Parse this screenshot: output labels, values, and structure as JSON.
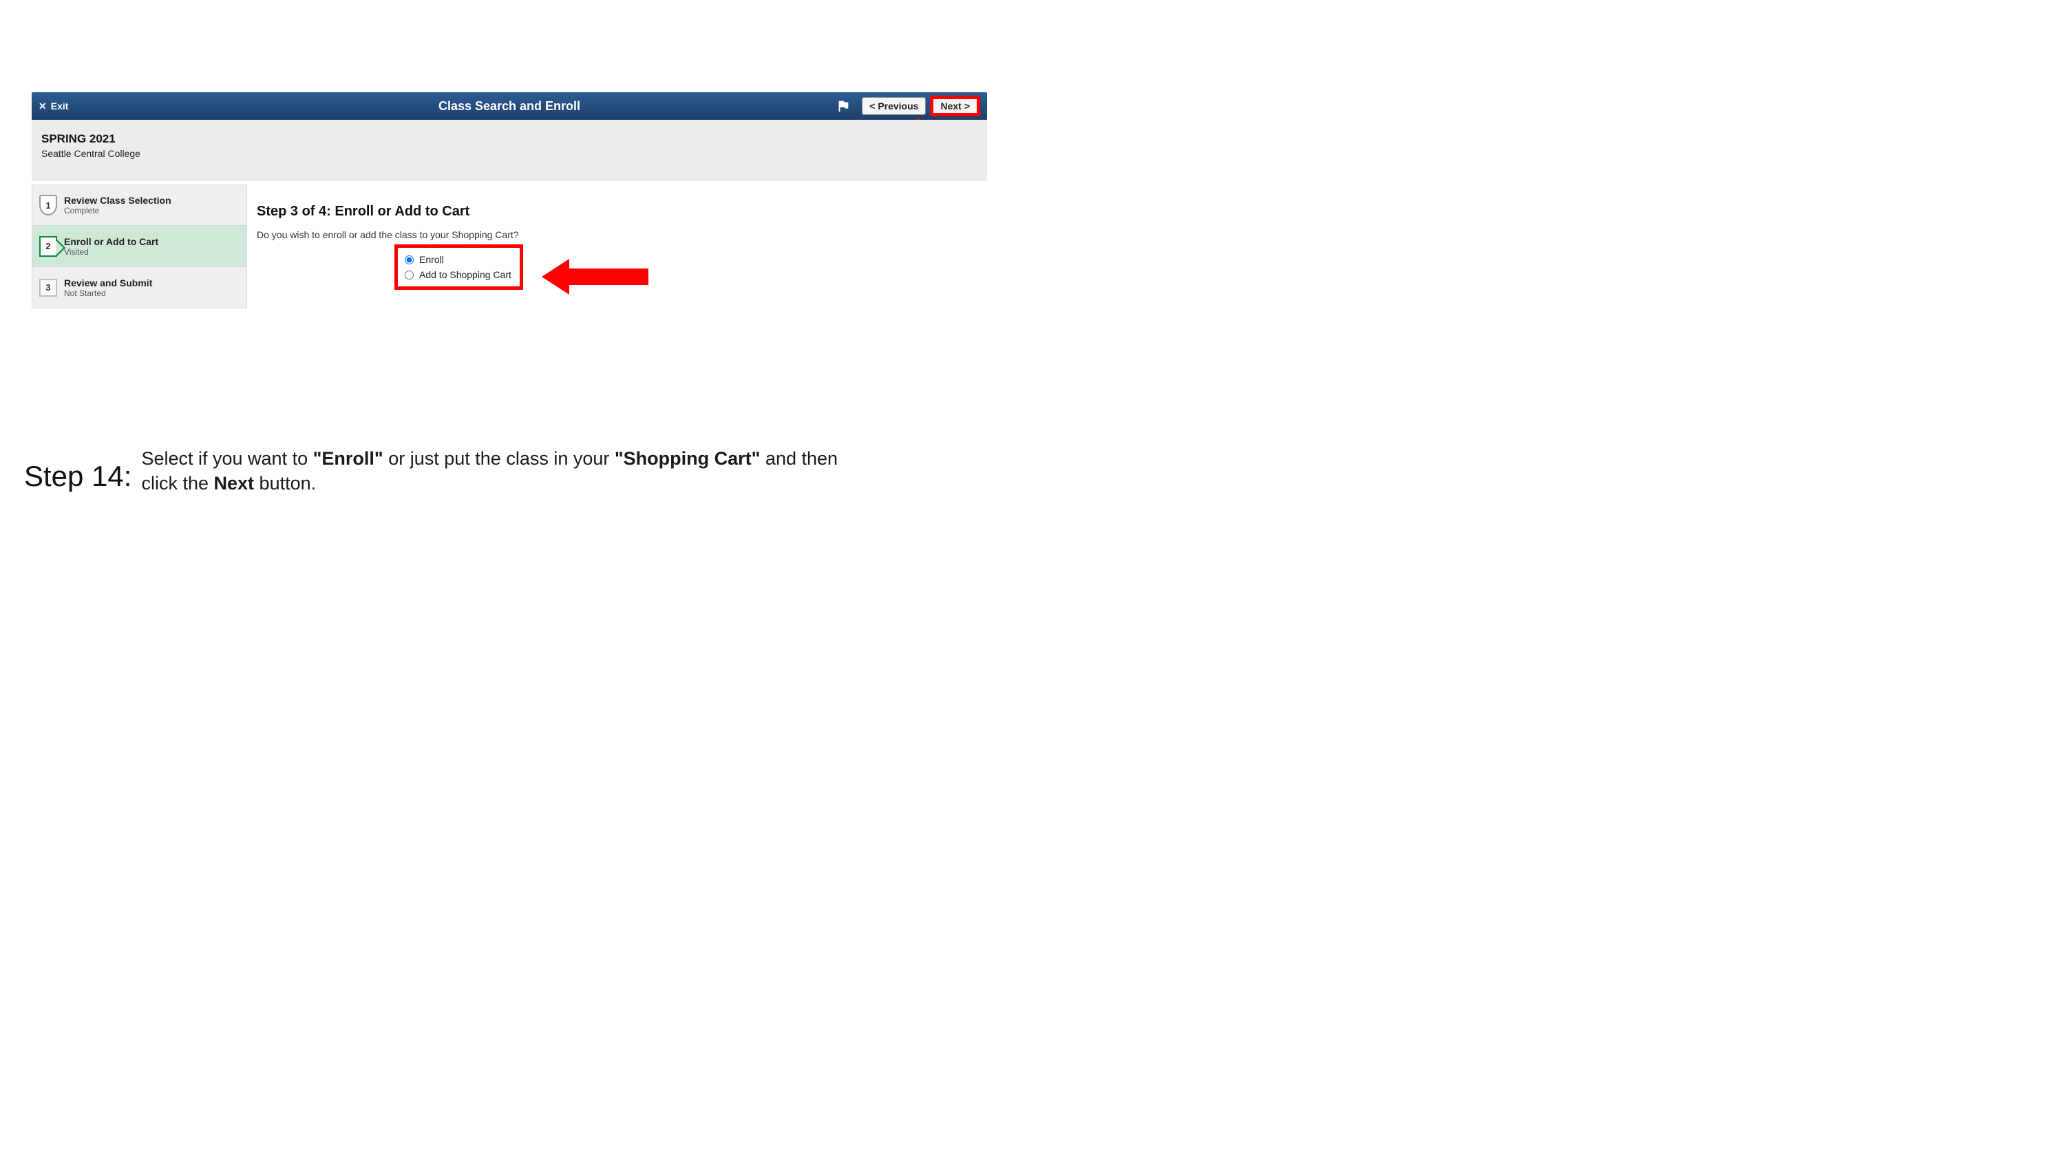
{
  "header": {
    "exit_label": "Exit",
    "title": "Class Search and Enroll",
    "previous_label": "Previous",
    "next_label": "Next"
  },
  "term_info": {
    "term": "SPRING 2021",
    "college": "Seattle Central College"
  },
  "steps": [
    {
      "num": "1",
      "title": "Review Class Selection",
      "status": "Complete"
    },
    {
      "num": "2",
      "title": "Enroll or Add to Cart",
      "status": "Visited"
    },
    {
      "num": "3",
      "title": "Review and Submit",
      "status": "Not Started"
    }
  ],
  "main": {
    "heading": "Step 3 of 4: Enroll or Add to Cart",
    "question": "Do you wish to enroll or add the class to your Shopping Cart?",
    "option_enroll": "Enroll",
    "option_cart": "Add to Shopping Cart"
  },
  "instruction": {
    "step_label": "Step 14:",
    "text_1": "Select if you want to ",
    "bold_1": "\"Enroll\"",
    "text_2": " or just put the class in your ",
    "bold_2": "\"Shopping Cart\"",
    "text_3": " and then click the ",
    "bold_3": "Next",
    "text_4": " button."
  }
}
